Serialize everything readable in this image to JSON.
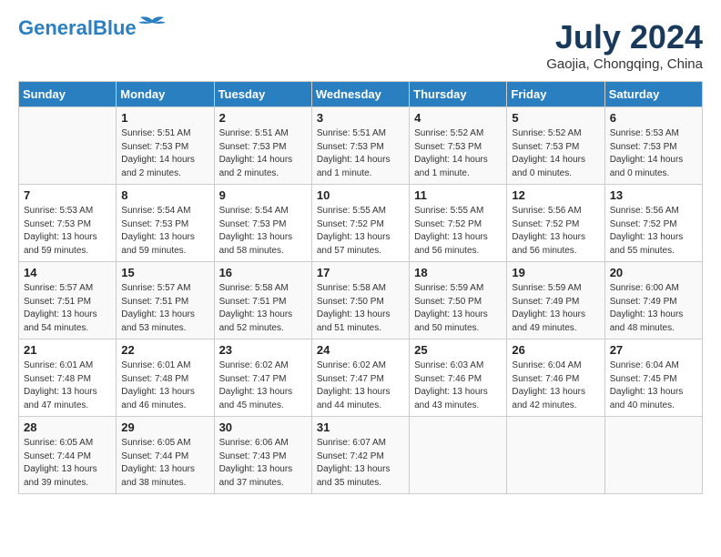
{
  "header": {
    "logo_line1": "General",
    "logo_line2": "Blue",
    "month_year": "July 2024",
    "location": "Gaojia, Chongqing, China"
  },
  "columns": [
    "Sunday",
    "Monday",
    "Tuesday",
    "Wednesday",
    "Thursday",
    "Friday",
    "Saturday"
  ],
  "weeks": [
    [
      {
        "day": "",
        "sunrise": "",
        "sunset": "",
        "daylight": ""
      },
      {
        "day": "1",
        "sunrise": "Sunrise: 5:51 AM",
        "sunset": "Sunset: 7:53 PM",
        "daylight": "Daylight: 14 hours and 2 minutes."
      },
      {
        "day": "2",
        "sunrise": "Sunrise: 5:51 AM",
        "sunset": "Sunset: 7:53 PM",
        "daylight": "Daylight: 14 hours and 2 minutes."
      },
      {
        "day": "3",
        "sunrise": "Sunrise: 5:51 AM",
        "sunset": "Sunset: 7:53 PM",
        "daylight": "Daylight: 14 hours and 1 minute."
      },
      {
        "day": "4",
        "sunrise": "Sunrise: 5:52 AM",
        "sunset": "Sunset: 7:53 PM",
        "daylight": "Daylight: 14 hours and 1 minute."
      },
      {
        "day": "5",
        "sunrise": "Sunrise: 5:52 AM",
        "sunset": "Sunset: 7:53 PM",
        "daylight": "Daylight: 14 hours and 0 minutes."
      },
      {
        "day": "6",
        "sunrise": "Sunrise: 5:53 AM",
        "sunset": "Sunset: 7:53 PM",
        "daylight": "Daylight: 14 hours and 0 minutes."
      }
    ],
    [
      {
        "day": "7",
        "sunrise": "Sunrise: 5:53 AM",
        "sunset": "Sunset: 7:53 PM",
        "daylight": "Daylight: 13 hours and 59 minutes."
      },
      {
        "day": "8",
        "sunrise": "Sunrise: 5:54 AM",
        "sunset": "Sunset: 7:53 PM",
        "daylight": "Daylight: 13 hours and 59 minutes."
      },
      {
        "day": "9",
        "sunrise": "Sunrise: 5:54 AM",
        "sunset": "Sunset: 7:53 PM",
        "daylight": "Daylight: 13 hours and 58 minutes."
      },
      {
        "day": "10",
        "sunrise": "Sunrise: 5:55 AM",
        "sunset": "Sunset: 7:52 PM",
        "daylight": "Daylight: 13 hours and 57 minutes."
      },
      {
        "day": "11",
        "sunrise": "Sunrise: 5:55 AM",
        "sunset": "Sunset: 7:52 PM",
        "daylight": "Daylight: 13 hours and 56 minutes."
      },
      {
        "day": "12",
        "sunrise": "Sunrise: 5:56 AM",
        "sunset": "Sunset: 7:52 PM",
        "daylight": "Daylight: 13 hours and 56 minutes."
      },
      {
        "day": "13",
        "sunrise": "Sunrise: 5:56 AM",
        "sunset": "Sunset: 7:52 PM",
        "daylight": "Daylight: 13 hours and 55 minutes."
      }
    ],
    [
      {
        "day": "14",
        "sunrise": "Sunrise: 5:57 AM",
        "sunset": "Sunset: 7:51 PM",
        "daylight": "Daylight: 13 hours and 54 minutes."
      },
      {
        "day": "15",
        "sunrise": "Sunrise: 5:57 AM",
        "sunset": "Sunset: 7:51 PM",
        "daylight": "Daylight: 13 hours and 53 minutes."
      },
      {
        "day": "16",
        "sunrise": "Sunrise: 5:58 AM",
        "sunset": "Sunset: 7:51 PM",
        "daylight": "Daylight: 13 hours and 52 minutes."
      },
      {
        "day": "17",
        "sunrise": "Sunrise: 5:58 AM",
        "sunset": "Sunset: 7:50 PM",
        "daylight": "Daylight: 13 hours and 51 minutes."
      },
      {
        "day": "18",
        "sunrise": "Sunrise: 5:59 AM",
        "sunset": "Sunset: 7:50 PM",
        "daylight": "Daylight: 13 hours and 50 minutes."
      },
      {
        "day": "19",
        "sunrise": "Sunrise: 5:59 AM",
        "sunset": "Sunset: 7:49 PM",
        "daylight": "Daylight: 13 hours and 49 minutes."
      },
      {
        "day": "20",
        "sunrise": "Sunrise: 6:00 AM",
        "sunset": "Sunset: 7:49 PM",
        "daylight": "Daylight: 13 hours and 48 minutes."
      }
    ],
    [
      {
        "day": "21",
        "sunrise": "Sunrise: 6:01 AM",
        "sunset": "Sunset: 7:48 PM",
        "daylight": "Daylight: 13 hours and 47 minutes."
      },
      {
        "day": "22",
        "sunrise": "Sunrise: 6:01 AM",
        "sunset": "Sunset: 7:48 PM",
        "daylight": "Daylight: 13 hours and 46 minutes."
      },
      {
        "day": "23",
        "sunrise": "Sunrise: 6:02 AM",
        "sunset": "Sunset: 7:47 PM",
        "daylight": "Daylight: 13 hours and 45 minutes."
      },
      {
        "day": "24",
        "sunrise": "Sunrise: 6:02 AM",
        "sunset": "Sunset: 7:47 PM",
        "daylight": "Daylight: 13 hours and 44 minutes."
      },
      {
        "day": "25",
        "sunrise": "Sunrise: 6:03 AM",
        "sunset": "Sunset: 7:46 PM",
        "daylight": "Daylight: 13 hours and 43 minutes."
      },
      {
        "day": "26",
        "sunrise": "Sunrise: 6:04 AM",
        "sunset": "Sunset: 7:46 PM",
        "daylight": "Daylight: 13 hours and 42 minutes."
      },
      {
        "day": "27",
        "sunrise": "Sunrise: 6:04 AM",
        "sunset": "Sunset: 7:45 PM",
        "daylight": "Daylight: 13 hours and 40 minutes."
      }
    ],
    [
      {
        "day": "28",
        "sunrise": "Sunrise: 6:05 AM",
        "sunset": "Sunset: 7:44 PM",
        "daylight": "Daylight: 13 hours and 39 minutes."
      },
      {
        "day": "29",
        "sunrise": "Sunrise: 6:05 AM",
        "sunset": "Sunset: 7:44 PM",
        "daylight": "Daylight: 13 hours and 38 minutes."
      },
      {
        "day": "30",
        "sunrise": "Sunrise: 6:06 AM",
        "sunset": "Sunset: 7:43 PM",
        "daylight": "Daylight: 13 hours and 37 minutes."
      },
      {
        "day": "31",
        "sunrise": "Sunrise: 6:07 AM",
        "sunset": "Sunset: 7:42 PM",
        "daylight": "Daylight: 13 hours and 35 minutes."
      },
      {
        "day": "",
        "sunrise": "",
        "sunset": "",
        "daylight": ""
      },
      {
        "day": "",
        "sunrise": "",
        "sunset": "",
        "daylight": ""
      },
      {
        "day": "",
        "sunrise": "",
        "sunset": "",
        "daylight": ""
      }
    ]
  ]
}
